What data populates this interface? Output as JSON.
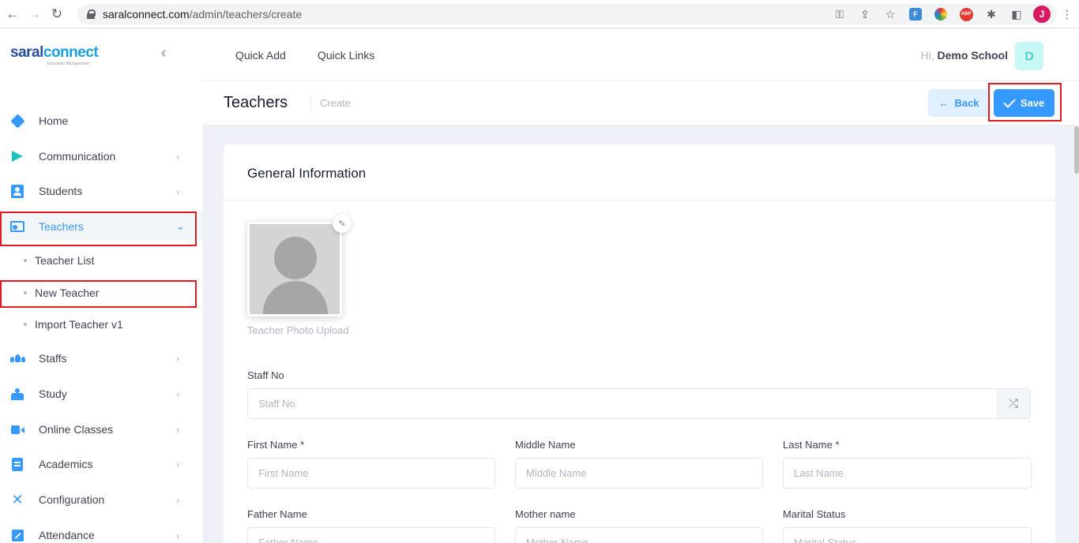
{
  "browser": {
    "url_domain": "saralconnect.com",
    "url_path": "/admin/teachers/create",
    "profile_initial": "J",
    "ext_ff": "F",
    "ext_abp": "ABP"
  },
  "brand": {
    "logo_part1": "saral",
    "logo_part2": "connect",
    "logo_tagline": "Education Management"
  },
  "sidebar": {
    "items": [
      {
        "label": "Home",
        "icon": "home-icon"
      },
      {
        "label": "Communication",
        "icon": "send-icon"
      },
      {
        "label": "Students",
        "icon": "student-icon"
      },
      {
        "label": "Teachers",
        "icon": "teacher-icon",
        "active": true
      },
      {
        "label": "Staffs",
        "icon": "staff-icon"
      },
      {
        "label": "Study",
        "icon": "study-icon"
      },
      {
        "label": "Online Classes",
        "icon": "video-icon"
      },
      {
        "label": "Academics",
        "icon": "book-icon"
      },
      {
        "label": "Configuration",
        "icon": "tools-icon"
      },
      {
        "label": "Attendance",
        "icon": "attendance-icon"
      }
    ],
    "teacher_sub": [
      {
        "label": "Teacher List"
      },
      {
        "label": "New Teacher"
      },
      {
        "label": "Import Teacher v1"
      }
    ]
  },
  "topbar": {
    "quick_add": "Quick Add",
    "quick_links": "Quick Links",
    "greeting": "Hi,",
    "user_name": "Demo School",
    "avatar_initial": "D"
  },
  "subheader": {
    "title": "Teachers",
    "crumb": "Create",
    "back_label": "Back",
    "save_label": "Save"
  },
  "form": {
    "section_title": "General Information",
    "photo_caption": "Teacher Photo Upload",
    "staff_no": {
      "label": "Staff No",
      "placeholder": "Staff No",
      "value": ""
    },
    "first_name": {
      "label": "First Name *",
      "placeholder": "First Name",
      "value": ""
    },
    "middle_name": {
      "label": "Middle Name",
      "placeholder": "Middle Name",
      "value": ""
    },
    "last_name": {
      "label": "Last Name *",
      "placeholder": "Last Name",
      "value": ""
    },
    "father_name": {
      "label": "Father Name",
      "placeholder": "Father Name",
      "value": ""
    },
    "mother_name": {
      "label": "Mother name",
      "placeholder": "Mother Name",
      "value": ""
    },
    "marital_status": {
      "label": "Marital Status",
      "placeholder": "Marital Status",
      "value": ""
    }
  },
  "colors": {
    "accent": "#3699ff",
    "highlight": "#e01b24",
    "sidebar_bg": "#ffffff",
    "page_bg": "#eef0f8"
  }
}
